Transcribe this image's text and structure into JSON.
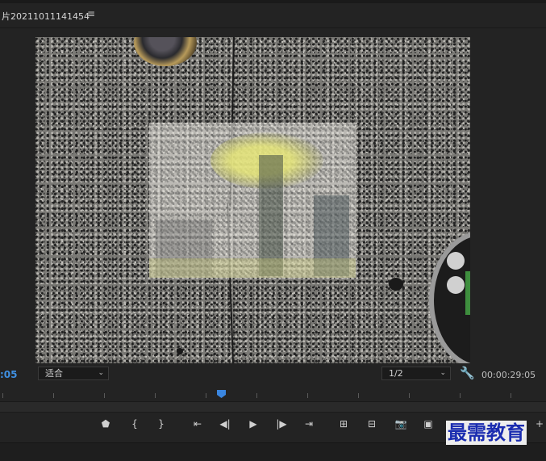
{
  "header": {
    "title": "片20211011141454",
    "menu_icon": "≡"
  },
  "viewer": {
    "description_icons": [
      "program-monitor"
    ]
  },
  "controls": {
    "timecode_left": ":05",
    "fit_select": "适合",
    "resolution_select": "1/2",
    "timecode_right": "00:00:29:05"
  },
  "transport": {
    "marker": "⬟",
    "in": "{",
    "out": "}",
    "go_in": "⇤",
    "step_back": "◀|",
    "play": "▶",
    "step_fwd": "|▶",
    "go_out": "⇥",
    "lift": "⊞",
    "extract": "⊟",
    "export_frame": "📷",
    "compare": "▣",
    "add": "+"
  },
  "watermark": "最需教育",
  "colors": {
    "accent": "#3a86e0",
    "background": "#232323",
    "watermark": "#1b2db0"
  }
}
